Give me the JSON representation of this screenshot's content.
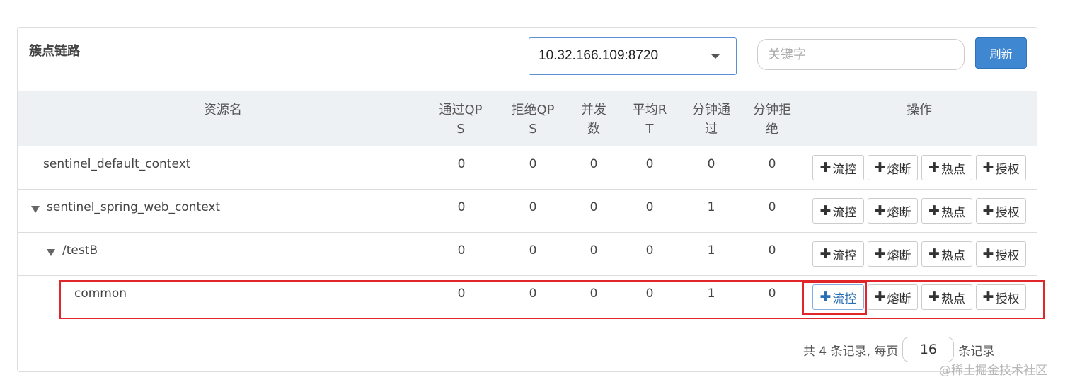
{
  "panel": {
    "title": "簇点链路"
  },
  "toolbar": {
    "machine_select_value": "10.32.166.109:8720",
    "search_placeholder": "关键字",
    "refresh_label": "刷新"
  },
  "columns": {
    "resource": "资源名",
    "pass_qps": [
      "通过QP",
      "S"
    ],
    "block_qps": [
      "拒绝QP",
      "S"
    ],
    "concurrency": [
      "并发",
      "数"
    ],
    "avg_rt": [
      "平均R",
      "T"
    ],
    "minute_pass": [
      "分钟通",
      "过"
    ],
    "minute_block": [
      "分钟拒",
      "绝"
    ],
    "actions": "操作"
  },
  "rows": [
    {
      "name": "sentinel_default_context",
      "pass_qps": "0",
      "block_qps": "0",
      "concurrency": "0",
      "avg_rt": "0",
      "minute_pass": "0",
      "minute_block": "0"
    },
    {
      "name": "sentinel_spring_web_context",
      "pass_qps": "0",
      "block_qps": "0",
      "concurrency": "0",
      "avg_rt": "0",
      "minute_pass": "1",
      "minute_block": "0"
    },
    {
      "name": "/testB",
      "pass_qps": "0",
      "block_qps": "0",
      "concurrency": "0",
      "avg_rt": "0",
      "minute_pass": "1",
      "minute_block": "0"
    },
    {
      "name": "common",
      "pass_qps": "0",
      "block_qps": "0",
      "concurrency": "0",
      "avg_rt": "0",
      "minute_pass": "1",
      "minute_block": "0"
    }
  ],
  "actions": {
    "plus": "✚",
    "flow": "流控",
    "degrade": "熔断",
    "hotspot": "热点",
    "auth": "授权"
  },
  "pager": {
    "prefix": "共 4 条记录, 每页",
    "page_size": "16",
    "suffix": "条记录"
  },
  "watermark": "@稀土掘金技术社区"
}
